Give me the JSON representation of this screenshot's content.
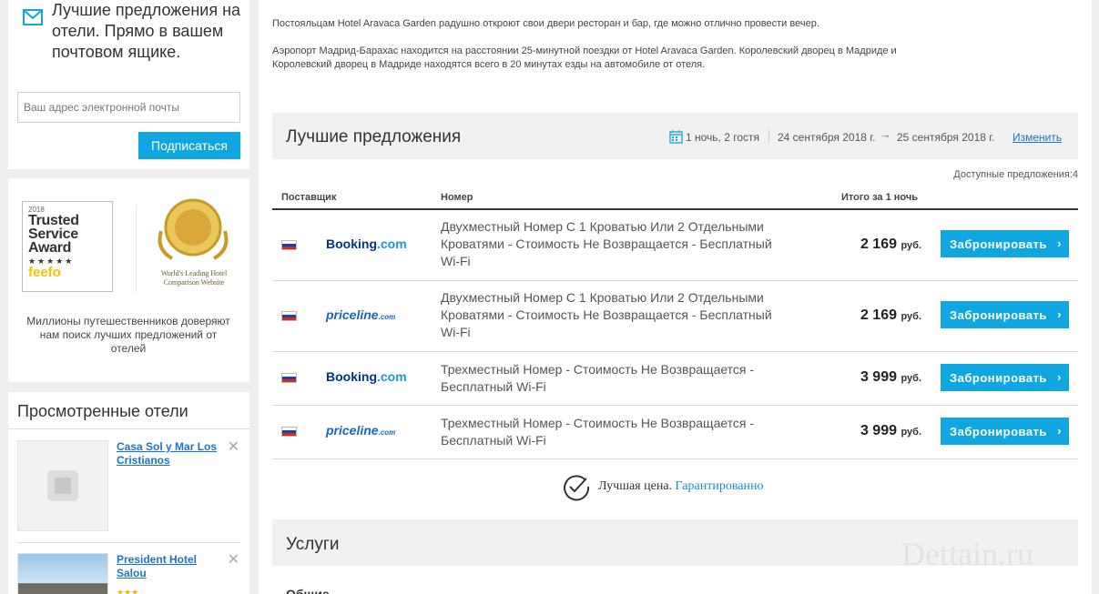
{
  "subscribe": {
    "title": "Лучшие предложения на отели. Прямо в вашем почтовом ящике.",
    "email_placeholder": "Ваш адрес электронной почты",
    "button": "Подписаться"
  },
  "awards": {
    "feefo_year": "2018",
    "feefo_title": "Trusted Service Award",
    "feefo_brand": "feefo",
    "wt_caption": "World's Leading Hotel Comparison Website",
    "text": "Миллионы путешественников доверяют нам поиск лучших предложений от отелей"
  },
  "viewed": {
    "title": "Просмотренные отели",
    "hotels": [
      {
        "name": "Casa Sol y Mar Los Cristianos"
      },
      {
        "name": "President Hotel Salou"
      }
    ]
  },
  "description": {
    "p1": "Постояльцам Hotel Aravaca Garden радушно откроют свои двери ресторан и бар, где можно отлично провести вечер.",
    "p2": "Аэропорт Мадрид-Барахас находится на расстоянии 25-минутной поездки от Hotel Aravaca Garden. Королевский дворец в Мадриде и Королевский дворец в Мадриде находятся всего в 20 минутах езды на автомобиле от отеля."
  },
  "offers": {
    "title": "Лучшие предложения",
    "guests": "1 ночь, 2 гостя",
    "checkin": "24 сентября 2018 г.",
    "checkout": "25 сентября 2018 г.",
    "change": "Изменить",
    "available": "Доступные предложения:4",
    "columns": {
      "provider": "Поставщик",
      "room": "Номер",
      "total": "Итого за 1 ночь"
    },
    "rows": [
      {
        "provider": "booking",
        "room": "Двухместный Номер С 1 Кроватью Или 2 Отдельными Кроватями - Стоимость Не Возвращается - Бесплатный Wi-Fi",
        "price": "2 169",
        "currency": "руб.",
        "button": "Забронировать"
      },
      {
        "provider": "priceline",
        "room": "Двухместный Номер С 1 Кроватью Или 2 Отдельными Кроватями - Стоимость Не Возвращается - Бесплатный Wi-Fi",
        "price": "2 169",
        "currency": "руб.",
        "button": "Забронировать"
      },
      {
        "provider": "booking",
        "room": "Трехместный Номер - Стоимость Не Возвращается - Бесплатный Wi-Fi",
        "price": "3 999",
        "currency": "руб.",
        "button": "Забронировать"
      },
      {
        "provider": "priceline",
        "room": "Трехместный Номер - Стоимость Не Возвращается - Бесплатный Wi-Fi",
        "price": "3 999",
        "currency": "руб.",
        "button": "Забронировать"
      }
    ],
    "provider_logos": {
      "booking_a": "Booking",
      "booking_b": ".com",
      "priceline_a": "priceline",
      "priceline_b": ".com"
    }
  },
  "guarantee": {
    "text": "Лучшая цена.",
    "link": "Гарантированно"
  },
  "services": {
    "title": "Услуги",
    "general_label": "Общие"
  },
  "watermark": "Dettain.ru",
  "colors": {
    "accent": "#10a7e0",
    "link": "#1a75c8"
  }
}
